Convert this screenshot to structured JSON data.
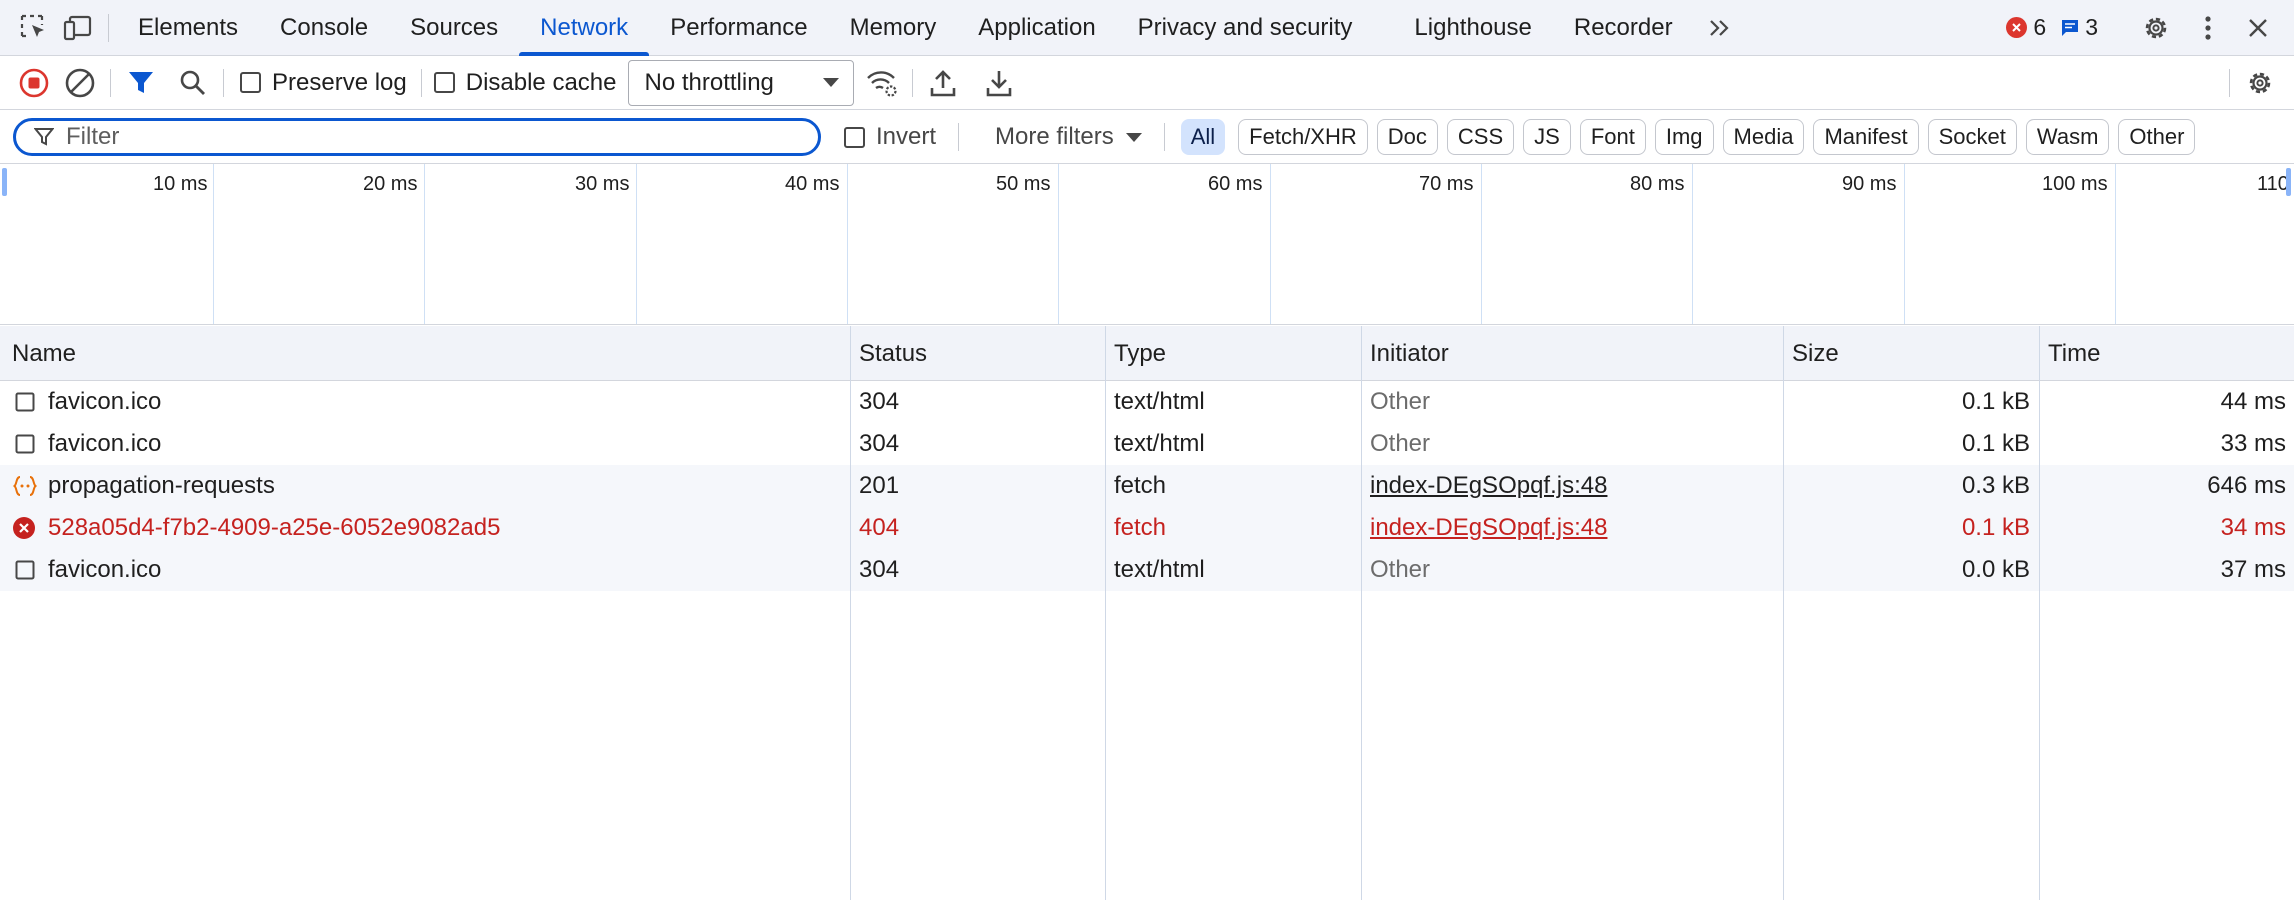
{
  "tabbar": {
    "tabs": [
      "Elements",
      "Console",
      "Sources",
      "Network",
      "Performance",
      "Memory",
      "Application",
      "Privacy and security",
      "Lighthouse",
      "Recorder"
    ],
    "active_tab": "Network",
    "error_count": "6",
    "message_count": "3"
  },
  "toolbar": {
    "preserve_log": "Preserve log",
    "disable_cache": "Disable cache",
    "throttling": "No throttling"
  },
  "filter": {
    "placeholder": "Filter",
    "invert": "Invert",
    "more_filters": "More filters",
    "types": [
      "All",
      "Fetch/XHR",
      "Doc",
      "CSS",
      "JS",
      "Font",
      "Img",
      "Media",
      "Manifest",
      "Socket",
      "Wasm",
      "Other"
    ],
    "active_type": "All"
  },
  "overview": {
    "ticks": [
      "10 ms",
      "20 ms",
      "30 ms",
      "40 ms",
      "50 ms",
      "60 ms",
      "70 ms",
      "80 ms",
      "90 ms",
      "100 ms",
      "110"
    ]
  },
  "table": {
    "columns": [
      "Name",
      "Status",
      "Type",
      "Initiator",
      "Size",
      "Time"
    ],
    "rows": [
      {
        "name": "favicon.ico",
        "status": "304",
        "type": "text/html",
        "initiator": "Other",
        "size": "0.1 kB",
        "time": "44 ms",
        "icon": "document-icon"
      },
      {
        "name": "favicon.ico",
        "status": "304",
        "type": "text/html",
        "initiator": "Other",
        "size": "0.1 kB",
        "time": "33 ms",
        "icon": "document-icon"
      },
      {
        "name": "propagation-requests",
        "status": "201",
        "type": "fetch",
        "initiator": "index-DEgSOpqf.js:48",
        "size": "0.3 kB",
        "time": "646 ms",
        "icon": "fetch-icon"
      },
      {
        "name": "528a05d4-f7b2-4909-a25e-6052e9082ad5",
        "status": "404",
        "type": "fetch",
        "initiator": "index-DEgSOpqf.js:48",
        "size": "0.1 kB",
        "time": "34 ms",
        "icon": "error-icon"
      },
      {
        "name": "favicon.ico",
        "status": "304",
        "type": "text/html",
        "initiator": "Other",
        "size": "0.0 kB",
        "time": "37 ms",
        "icon": "document-icon"
      }
    ]
  },
  "colors": {
    "accent": "#0b57d0",
    "error": "#c5221f",
    "record": "#dc362e",
    "fetch_icon": "#e8710a"
  }
}
